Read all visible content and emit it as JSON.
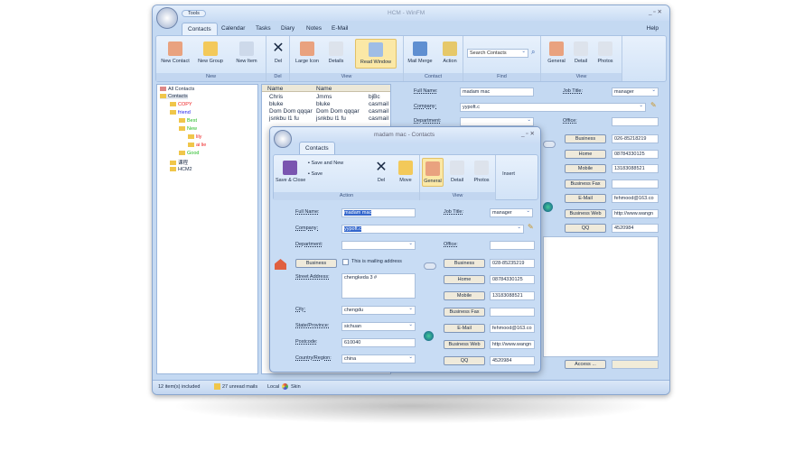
{
  "window": {
    "title": "HCM - WinFM",
    "qat_label": "Tools",
    "help": "Help"
  },
  "tabs": [
    "Contacts",
    "Calendar",
    "Tasks",
    "Diary",
    "Notes",
    "E-Mail"
  ],
  "ribbon": {
    "groups": [
      "New",
      "Del",
      "View",
      "Contact",
      "Find",
      "View"
    ],
    "buttons": [
      "New Contact",
      "New Group",
      "New Item",
      "Del",
      "Large Icon",
      "Details",
      "Read Window",
      "Mail Merge",
      "Action",
      "General",
      "Detail",
      "Photos"
    ],
    "search_placeholder": "Search Contacts"
  },
  "tree": [
    "All Contacts",
    "Contacts",
    "COPY",
    "friend",
    "Best",
    "New",
    "lily",
    "ai lie",
    "Good",
    "课程",
    "HCM2"
  ],
  "list": {
    "columns": [
      "Name",
      "Name"
    ],
    "rows": [
      [
        "Chris",
        "Jmms",
        "bjBc"
      ],
      [
        "bluke",
        "bluke",
        "casmail"
      ],
      [
        "Dom Dom qqqar",
        "Dom Dom qqqar",
        "casmail"
      ],
      [
        "jsnkbu l1 fu",
        "jsnkbu l1 fu",
        "casmail"
      ]
    ]
  },
  "detail": {
    "full_name_label": "Full Name:",
    "full_name": "madam mac",
    "job_title_label": "Job Title:",
    "job_title": "manager",
    "company_label": "Company:",
    "company": "yypoft.c",
    "department_label": "Department:",
    "office_label": "Office:",
    "phones": [
      [
        "Business",
        "026-85218219"
      ],
      [
        "Home",
        "08784330125"
      ],
      [
        "Mobile",
        "13183088521"
      ],
      [
        "Business Fax",
        ""
      ],
      [
        "E-Mail",
        "fehmood@163.co"
      ],
      [
        "Business Web",
        "http://www.wangn"
      ],
      [
        "QQ",
        "4520984"
      ]
    ],
    "access": "Access ..."
  },
  "popup": {
    "title": "madam mac - Contacts",
    "tab": "Contacts",
    "buttons": [
      "Save & Close",
      "Save and New",
      "Save",
      "Del",
      "Move",
      "General",
      "Detail",
      "Photos",
      "Insert"
    ],
    "groups": [
      "Action",
      "View"
    ],
    "full_name_label": "Full Name:",
    "full_name": "madam mac",
    "job_title_label": "Job Title:",
    "job_title": "manager",
    "company_label": "Company:",
    "company": "yypoft.c",
    "department_label": "Department:",
    "office_label": "Office:",
    "address_button": "Business",
    "mailing_label": "This is mailing address",
    "street_label": "Street Address:",
    "street": "chengkeda 3 #",
    "city_label": "City:",
    "city": "chengdu",
    "state_label": "State/Province:",
    "state": "sichuan",
    "postcode_label": "Postcode:",
    "postcode": "610040",
    "country_label": "Country/Region:",
    "country": "china",
    "phones": [
      [
        "Business",
        "028-85235219"
      ],
      [
        "Home",
        "08784330125"
      ],
      [
        "Mobile",
        "13183088521"
      ],
      [
        "Business Fax",
        ""
      ],
      [
        "E-Mail",
        "fehmood@163.co"
      ],
      [
        "Business Web",
        "http://www.wangn"
      ],
      [
        "QQ",
        "4520984"
      ]
    ]
  },
  "status": {
    "items": "12 item(s) included",
    "unread": "27 unread mails",
    "local": "Local",
    "skin": "Skin"
  }
}
